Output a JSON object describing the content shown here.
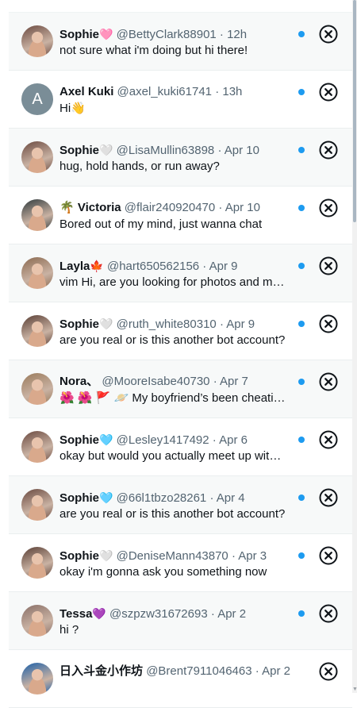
{
  "colors": {
    "accent": "#1d9bf0",
    "unread_bg": "#f7f9f9",
    "text": "#0f1419",
    "muted": "#536471"
  },
  "messages": [
    {
      "name": "Sophie",
      "emoji": "🩷",
      "handle": "@BettyClark88901",
      "sep": "·",
      "time": "12h",
      "preview": "not sure what i'm doing but hi there!",
      "unread": true,
      "avatar": "photo",
      "avatar_color": "#6b4a40"
    },
    {
      "name": "Axel Kuki",
      "emoji": "",
      "handle": "@axel_kuki61741",
      "sep": "·",
      "time": "13h",
      "preview": "Hi👋",
      "unread": false,
      "avatar": "letter",
      "avatar_letter": "A",
      "avatar_color": "#7a8d97"
    },
    {
      "name": "Sophie",
      "emoji": "🤍",
      "handle": "@LisaMullin63898",
      "sep": "·",
      "time": "Apr 10",
      "preview": "hug, hold hands, or run away?",
      "unread": true,
      "avatar": "photo",
      "avatar_color": "#6b4a40"
    },
    {
      "name": "🌴 Victoria",
      "emoji": "",
      "handle": "@flair240920470",
      "sep": "·",
      "time": "Apr 10",
      "preview": "Bored out of my mind, just wanna chat",
      "unread": false,
      "avatar": "photo",
      "avatar_color": "#2f3a3d"
    },
    {
      "name": "Layla",
      "emoji": "🍁",
      "handle": "@hart650562156",
      "sep": "·",
      "time": "Apr 9",
      "preview": "vim Hi, are you looking for photos and more?",
      "unread": true,
      "avatar": "photo",
      "avatar_color": "#8b6a50"
    },
    {
      "name": "Sophie",
      "emoji": "🤍",
      "handle": "@ruth_white80310",
      "sep": "·",
      "time": "Apr 9",
      "preview": "are you real or is this another bot account?",
      "unread": false,
      "avatar": "photo",
      "avatar_color": "#5a3f35"
    },
    {
      "name": "Nora、",
      "emoji": "",
      "handle": "@MooreIsabe40730",
      "sep": "·",
      "time": "Apr 7",
      "preview": "🌺 🌺 🚩 🪐 My boyfriend’s been cheating on me",
      "unread": true,
      "avatar": "photo",
      "avatar_color": "#9a7b5c"
    },
    {
      "name": "Sophie",
      "emoji": "🩵",
      "handle": "@Lesley1417492",
      "sep": "·",
      "time": "Apr 6",
      "preview": "okay but would you actually meet up with me?",
      "unread": false,
      "avatar": "photo",
      "avatar_color": "#6b4a40"
    },
    {
      "name": "Sophie",
      "emoji": "🩵",
      "handle": "@66l1tbzo28261",
      "sep": "·",
      "time": "Apr 4",
      "preview": "are you real or is this another bot account?",
      "unread": true,
      "avatar": "photo",
      "avatar_color": "#6b4a40"
    },
    {
      "name": "Sophie",
      "emoji": "🤍",
      "handle": "@DeniseMann43870",
      "sep": "·",
      "time": "Apr 3",
      "preview": "okay i'm gonna ask you something now",
      "unread": false,
      "avatar": "photo",
      "avatar_color": "#5a3f35"
    },
    {
      "name": "Tessa",
      "emoji": "💜",
      "handle": "@szpzw31672693",
      "sep": "·",
      "time": "Apr 2",
      "preview": "hi ?",
      "unread": true,
      "avatar": "photo",
      "avatar_color": "#8a7068"
    },
    {
      "name": "日入斗金小作坊",
      "emoji": "",
      "handle": "@Brent7911046463",
      "sep": "·",
      "time": "Apr 2",
      "preview": "",
      "unread": false,
      "avatar": "photo",
      "avatar_color": "#1b5fa8"
    }
  ]
}
